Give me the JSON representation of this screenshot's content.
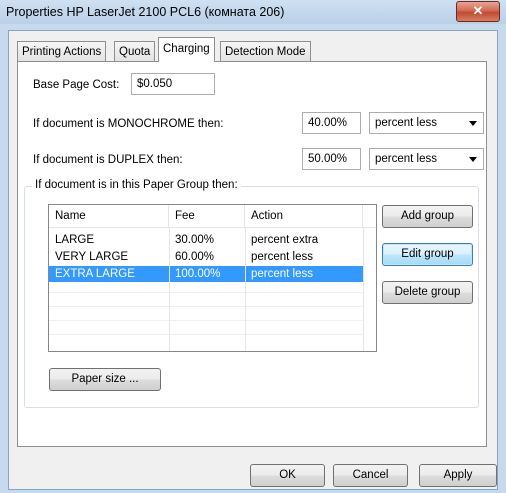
{
  "window": {
    "title": "Properties HP LaserJet 2100 PCL6 (комната 206)",
    "close_glyph": "✕"
  },
  "tabs": [
    {
      "label": "Printing Actions"
    },
    {
      "label": "Quota"
    },
    {
      "label": "Charging"
    },
    {
      "label": "Detection Mode"
    }
  ],
  "active_tab": "Charging",
  "base_cost": {
    "label": "Base Page Cost:",
    "value": "$0.050"
  },
  "mono": {
    "label": "If document is MONOCHROME then:",
    "value": "40.00%",
    "mode": "percent less"
  },
  "duplex": {
    "label": "If document is DUPLEX then:",
    "value": "50.00%",
    "mode": "percent less"
  },
  "paper_group": {
    "title": "If document is in this Paper Group then:",
    "columns": [
      "Name",
      "Fee",
      "Action"
    ],
    "rows": [
      [
        "LARGE",
        "30.00%",
        "percent extra"
      ],
      [
        "VERY LARGE",
        "60.00%",
        "percent less"
      ],
      [
        "EXTRA LARGE",
        "100.00%",
        "percent less"
      ]
    ],
    "selected_row": 2,
    "add_label": "Add group",
    "edit_label": "Edit group",
    "delete_label": "Delete group",
    "paper_size_label": "Paper size ..."
  },
  "footer": {
    "ok_label": "OK",
    "cancel_label": "Cancel",
    "apply_label": "Apply"
  }
}
